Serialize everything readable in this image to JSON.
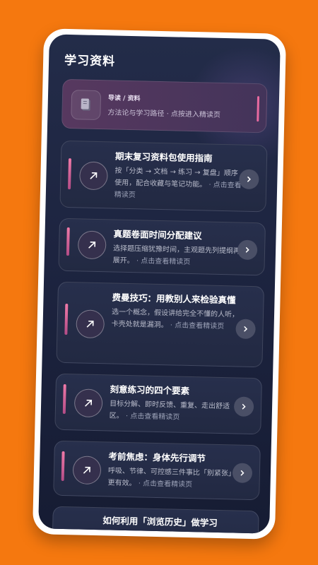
{
  "page": {
    "title": "学习资料"
  },
  "nav_card": {
    "kicker": "导读 / 资料",
    "description": "方法论与学习路径 · 点按进入精读页",
    "icon": "book-icon"
  },
  "articles": [
    {
      "title": "期末复习资料包使用指南",
      "summary": "按「分类 → 文档 → 练习 → 复盘」顺序使用，配合收藏与笔记功能。",
      "hint": "· 点击查看精读页"
    },
    {
      "title": "真题卷面时间分配建议",
      "summary": "选择题压缩犹豫时间，主观题先列提纲再展开。",
      "hint": "· 点击查看精读页"
    },
    {
      "title": "费曼技巧：用教别人来检验真懂",
      "summary": "选一个概念，假设讲给完全不懂的人听，卡壳处就是漏洞。",
      "hint": "· 点击查看精读页"
    },
    {
      "title": "刻意练习的四个要素",
      "summary": "目标分解、即时反馈、重复、走出舒适区。",
      "hint": "· 点击查看精读页"
    },
    {
      "title": "考前焦虑：身体先行调节",
      "summary": "呼吸、节律、可控感三件事比「别紧张」更有效。",
      "hint": "· 点击查看精读页"
    },
    {
      "title": "如何利用「浏览历史」做学习",
      "summary": "",
      "hint": ""
    }
  ],
  "icons": {
    "card_icon": "arrow-up-right-icon",
    "card_arrow": "chevron-right-icon"
  },
  "colors": {
    "background": "#f5780f",
    "screen": "#1d2440",
    "accent": "#e86aa0"
  }
}
